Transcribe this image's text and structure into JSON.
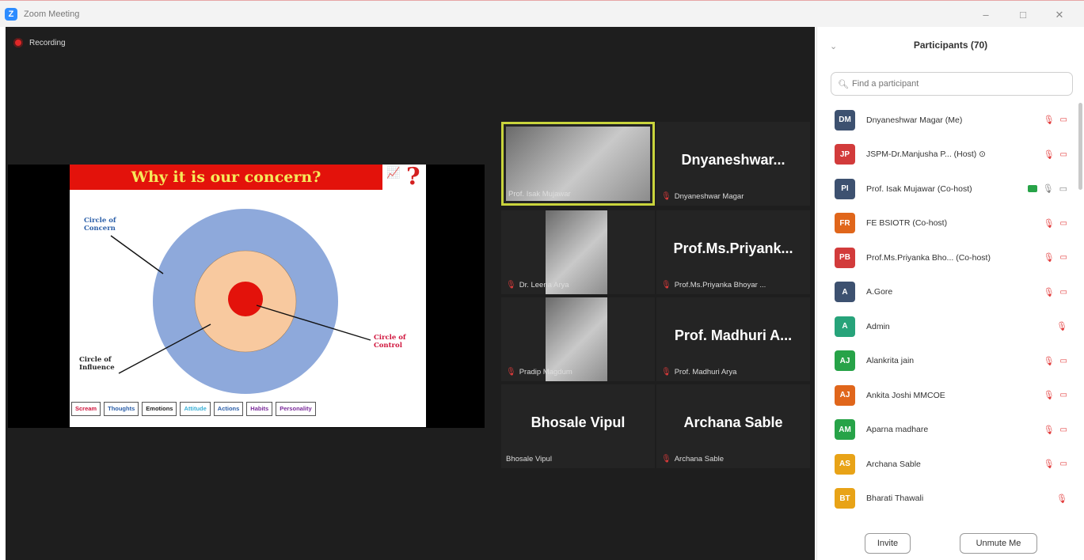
{
  "window": {
    "title": "Zoom Meeting",
    "controls": [
      "–",
      "□",
      "✕"
    ]
  },
  "recording": {
    "label": "Recording"
  },
  "slide": {
    "title": "Why it is our concern?",
    "question_mark": "?",
    "label_concern": "Circle of Concern",
    "label_influence": "Circle of Influence",
    "label_control": "Circle of Control",
    "keywords": [
      {
        "text": "Scream",
        "color": "#d0143c"
      },
      {
        "text": "Thoughts",
        "color": "#2a5ea8"
      },
      {
        "text": "Emotions",
        "color": "#222222"
      },
      {
        "text": "Attitude",
        "color": "#3ab0d6"
      },
      {
        "text": "Actions",
        "color": "#2a5ea8"
      },
      {
        "text": "Habits",
        "color": "#7a2a9a"
      },
      {
        "text": "Personality",
        "color": "#7a2a9a"
      }
    ],
    "colors": {
      "concern": "#8ea9db",
      "influence": "#f8c99f",
      "control": "#e3120b"
    }
  },
  "tiles": [
    {
      "big": "",
      "name": "Prof. Isak Mujawar",
      "muted": false,
      "video": true,
      "active": true
    },
    {
      "big": "Dnyaneshwar...",
      "name": "Dnyaneshwar Magar",
      "muted": true,
      "video": false,
      "active": false
    },
    {
      "big": "",
      "name": "Dr. Leena Arya",
      "muted": true,
      "video": true,
      "active": false
    },
    {
      "big": "Prof.Ms.Priyank...",
      "name": "Prof.Ms.Priyanka Bhoyar ...",
      "muted": true,
      "video": false,
      "active": false
    },
    {
      "big": "",
      "name": "Pradip Magdum",
      "muted": true,
      "video": true,
      "active": false
    },
    {
      "big": "Prof. Madhuri A...",
      "name": "Prof. Madhuri Arya",
      "muted": true,
      "video": false,
      "active": false
    },
    {
      "big": "Bhosale Vipul",
      "name": "Bhosale Vipul",
      "muted": false,
      "video": false,
      "active": false
    },
    {
      "big": "Archana Sable",
      "name": "Archana Sable",
      "muted": true,
      "video": false,
      "active": false
    }
  ],
  "participants": {
    "title": "Participants (70)",
    "search_placeholder": "Find a participant",
    "list": [
      {
        "initials": "DM",
        "name": "Dnyaneshwar Magar (Me)",
        "color": "#3d5170",
        "mic": "muted",
        "cam": "off"
      },
      {
        "initials": "JP",
        "name": "JSPM-Dr.Manjusha P... (Host) ⊙",
        "color": "#d23b3b",
        "mic": "muted",
        "cam": "off"
      },
      {
        "initials": "PI",
        "name": "Prof. Isak Mujawar (Co-host)",
        "color": "#3d5170",
        "mic": "on",
        "cam": "on",
        "sharing": true
      },
      {
        "initials": "FR",
        "name": "FE BSIOTR (Co-host)",
        "color": "#e0661b",
        "mic": "muted",
        "cam": "off"
      },
      {
        "initials": "PB",
        "name": "Prof.Ms.Priyanka Bho... (Co-host)",
        "color": "#d23b3b",
        "mic": "muted",
        "cam": "off"
      },
      {
        "initials": "A",
        "name": "A.Gore",
        "color": "#3d5170",
        "mic": "muted",
        "cam": "off"
      },
      {
        "initials": "A",
        "name": "Admin",
        "color": "#27a37a",
        "mic": "muted",
        "cam": ""
      },
      {
        "initials": "AJ",
        "name": "Alankrita jain",
        "color": "#27a348",
        "mic": "muted",
        "cam": "off"
      },
      {
        "initials": "AJ",
        "name": "Ankita Joshi MMCOE",
        "color": "#e0661b",
        "mic": "muted",
        "cam": "off"
      },
      {
        "initials": "AM",
        "name": "Aparna madhare",
        "color": "#27a348",
        "mic": "muted",
        "cam": "off"
      },
      {
        "initials": "AS",
        "name": "Archana Sable",
        "color": "#e8a317",
        "mic": "muted",
        "cam": "off"
      },
      {
        "initials": "BT",
        "name": "Bharati Thawali",
        "color": "#e8a317",
        "mic": "muted",
        "cam": ""
      }
    ],
    "invite_label": "Invite",
    "unmute_label": "Unmute Me"
  }
}
